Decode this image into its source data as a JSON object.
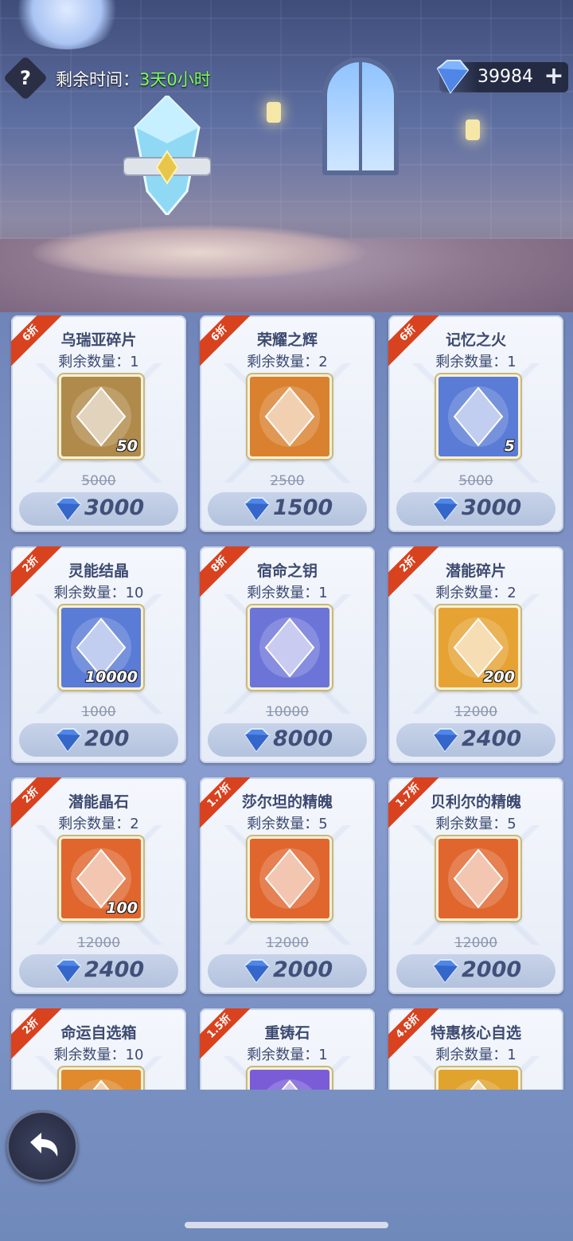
{
  "header": {
    "help_symbol": "?",
    "timer_label": "剩余时间：",
    "timer_value": "3天0小时",
    "currency_amount": "39984",
    "currency_plus": "+",
    "currency_icon": "diamond-icon"
  },
  "shop_items": [
    {
      "discount": "6折",
      "name": "乌瑞亚碎片",
      "stock": "剩余数量：1",
      "qty": "50",
      "old_price": "5000",
      "price": "3000",
      "icon": "hero-shard-icon",
      "color": "#b08a4a"
    },
    {
      "discount": "6折",
      "name": "荣耀之辉",
      "stock": "剩余数量：2",
      "qty": "",
      "old_price": "2500",
      "price": "1500",
      "icon": "glory-orb-icon",
      "color": "#d9812e"
    },
    {
      "discount": "6折",
      "name": "记忆之火",
      "stock": "剩余数量：1",
      "qty": "5",
      "old_price": "5000",
      "price": "3000",
      "icon": "memory-flame-icon",
      "color": "#5a7bd6"
    },
    {
      "discount": "2折",
      "name": "灵能结晶",
      "stock": "剩余数量：10",
      "qty": "10000",
      "old_price": "1000",
      "price": "200",
      "icon": "psionic-crystal-icon",
      "color": "#5a7bd6"
    },
    {
      "discount": "8折",
      "name": "宿命之钥",
      "stock": "剩余数量：1",
      "qty": "",
      "old_price": "10000",
      "price": "8000",
      "icon": "destiny-key-icon",
      "color": "#6d74d8"
    },
    {
      "discount": "2折",
      "name": "潜能碎片",
      "stock": "剩余数量：2",
      "qty": "200",
      "old_price": "12000",
      "price": "2400",
      "icon": "potential-shard-icon",
      "color": "#e6a334"
    },
    {
      "discount": "2折",
      "name": "潜能晶石",
      "stock": "剩余数量：2",
      "qty": "100",
      "old_price": "12000",
      "price": "2400",
      "icon": "potential-stone-icon",
      "color": "#e0662d"
    },
    {
      "discount": "1.7折",
      "name": "莎尔坦的精魄",
      "stock": "剩余数量：5",
      "qty": "",
      "old_price": "12000",
      "price": "2000",
      "icon": "dark-soul-orb-icon",
      "color": "#e0662d"
    },
    {
      "discount": "1.7折",
      "name": "贝利尔的精魄",
      "stock": "剩余数量：5",
      "qty": "",
      "old_price": "12000",
      "price": "2000",
      "icon": "red-soul-orb-icon",
      "color": "#e0662d"
    },
    {
      "discount": "2折",
      "name": "命运自选箱",
      "stock": "剩余数量：10",
      "qty": "",
      "old_price": "",
      "price": "",
      "icon": "fate-chest-icon",
      "color": "#e08a2d"
    },
    {
      "discount": "1.5折",
      "name": "重铸石",
      "stock": "剩余数量：1",
      "qty": "",
      "old_price": "",
      "price": "",
      "icon": "reforge-stone-icon",
      "color": "#7a5cd6"
    },
    {
      "discount": "4.8折",
      "name": "特惠核心自选",
      "stock": "剩余数量：1",
      "qty": "",
      "old_price": "",
      "price": "",
      "icon": "core-select-icon",
      "color": "#e0a32d"
    }
  ],
  "footer": {
    "back_icon": "back-arrow-icon"
  }
}
